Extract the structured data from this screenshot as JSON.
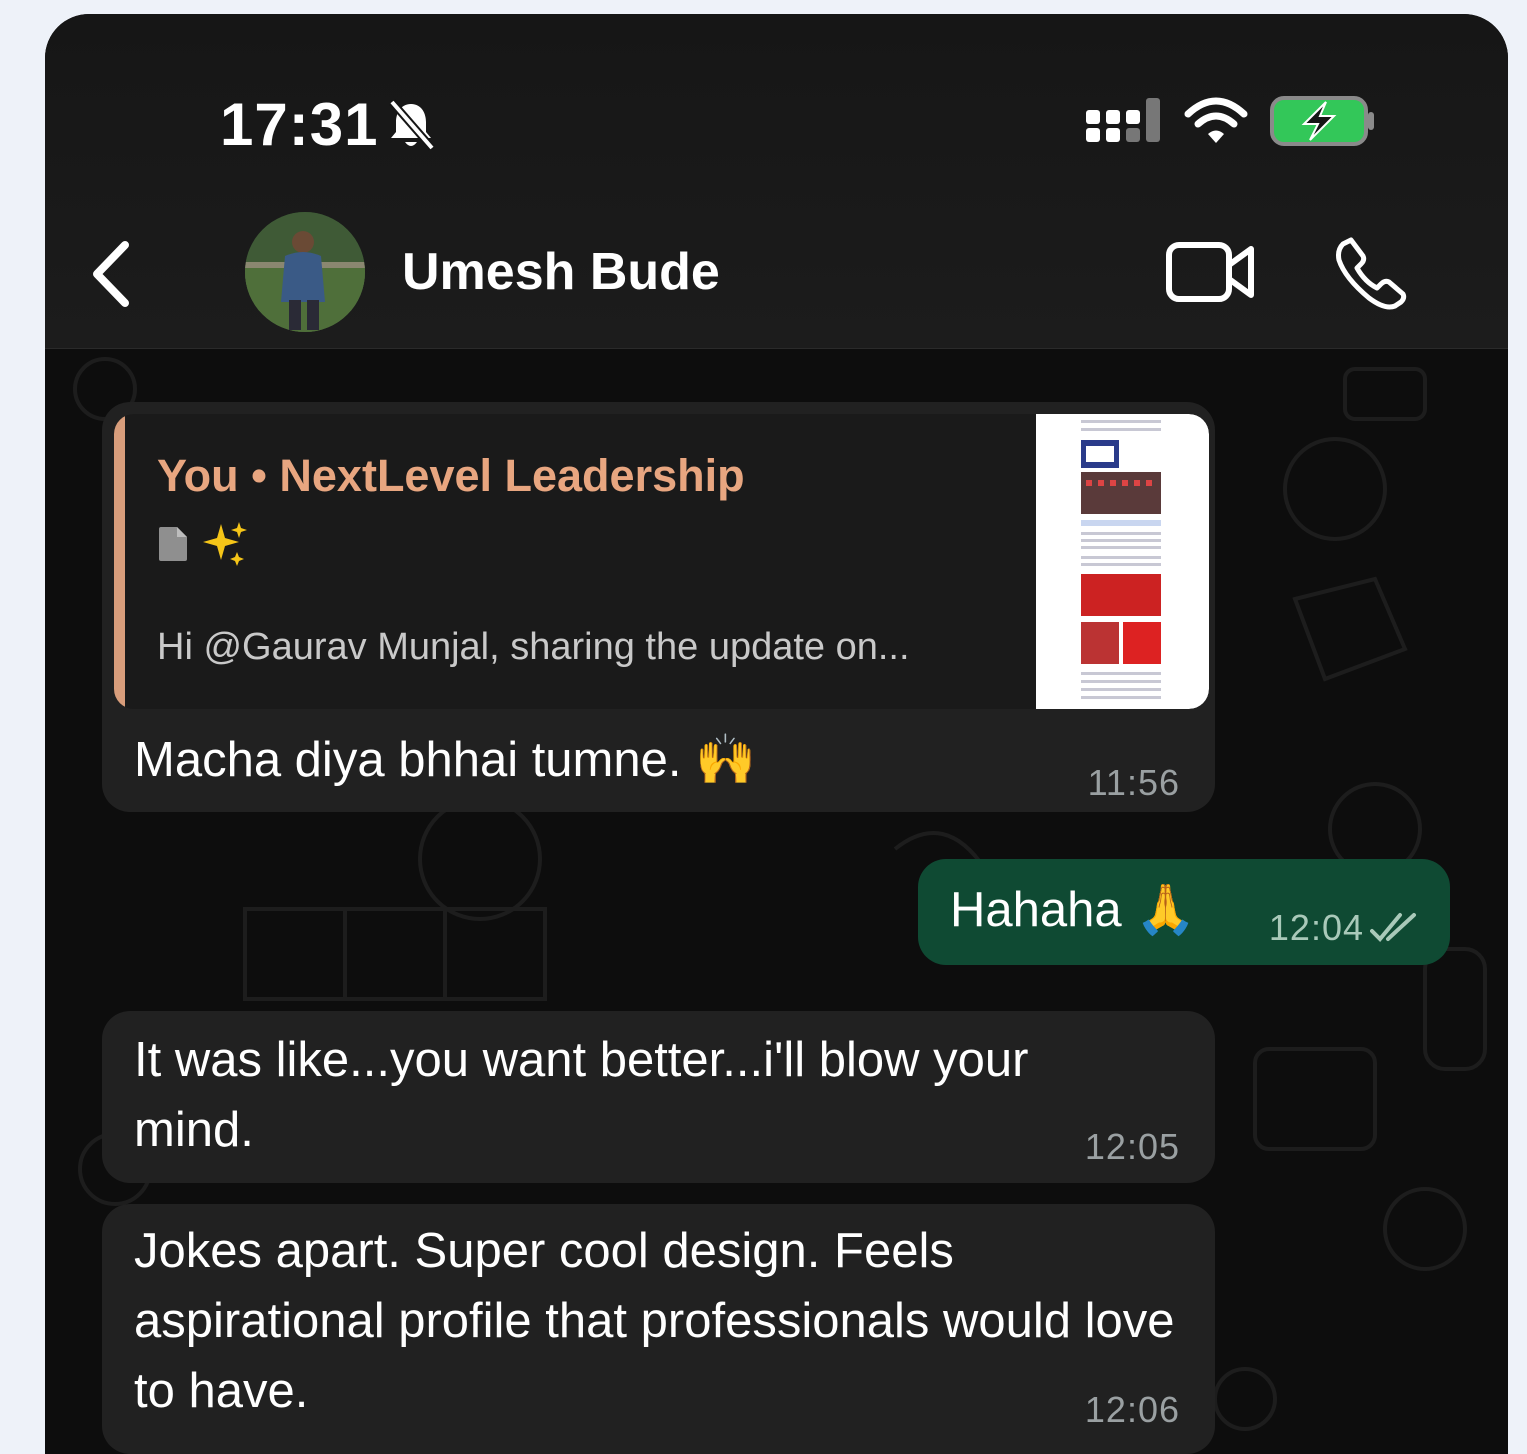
{
  "status_bar": {
    "time": "17:31",
    "icons": [
      "bell-slash-icon",
      "signal-icon",
      "wifi-icon",
      "battery-charging-icon"
    ],
    "battery_color": "#33c759"
  },
  "header": {
    "contact_name": "Umesh Bude",
    "icons": [
      "back-chevron-icon",
      "video-call-icon",
      "phone-call-icon"
    ]
  },
  "messages": [
    {
      "direction": "incoming",
      "quote": {
        "title": "You • NextLevel Leadership",
        "preview": "Hi @Gaurav Munjal, sharing the update on...",
        "icons": [
          "document-icon",
          "sparkles-icon"
        ],
        "accent": "#d89d7b"
      },
      "text": "Macha diya bhhai tumne. 🙌",
      "time": "11:56"
    },
    {
      "direction": "outgoing",
      "text": "Hahaha 🙏",
      "time": "12:04",
      "status_icon": "double-check-icon"
    },
    {
      "direction": "incoming",
      "text": "It was like...you want better...i'll blow your mind.",
      "time": "12:05"
    },
    {
      "direction": "incoming",
      "text": "Jokes apart. Super cool design. Feels aspirational profile that professionals would love to have.",
      "time": "12:06"
    }
  ],
  "colors": {
    "incoming_bubble": "#212121",
    "outgoing_bubble": "#0f4a33",
    "background": "#0d0d0d"
  }
}
